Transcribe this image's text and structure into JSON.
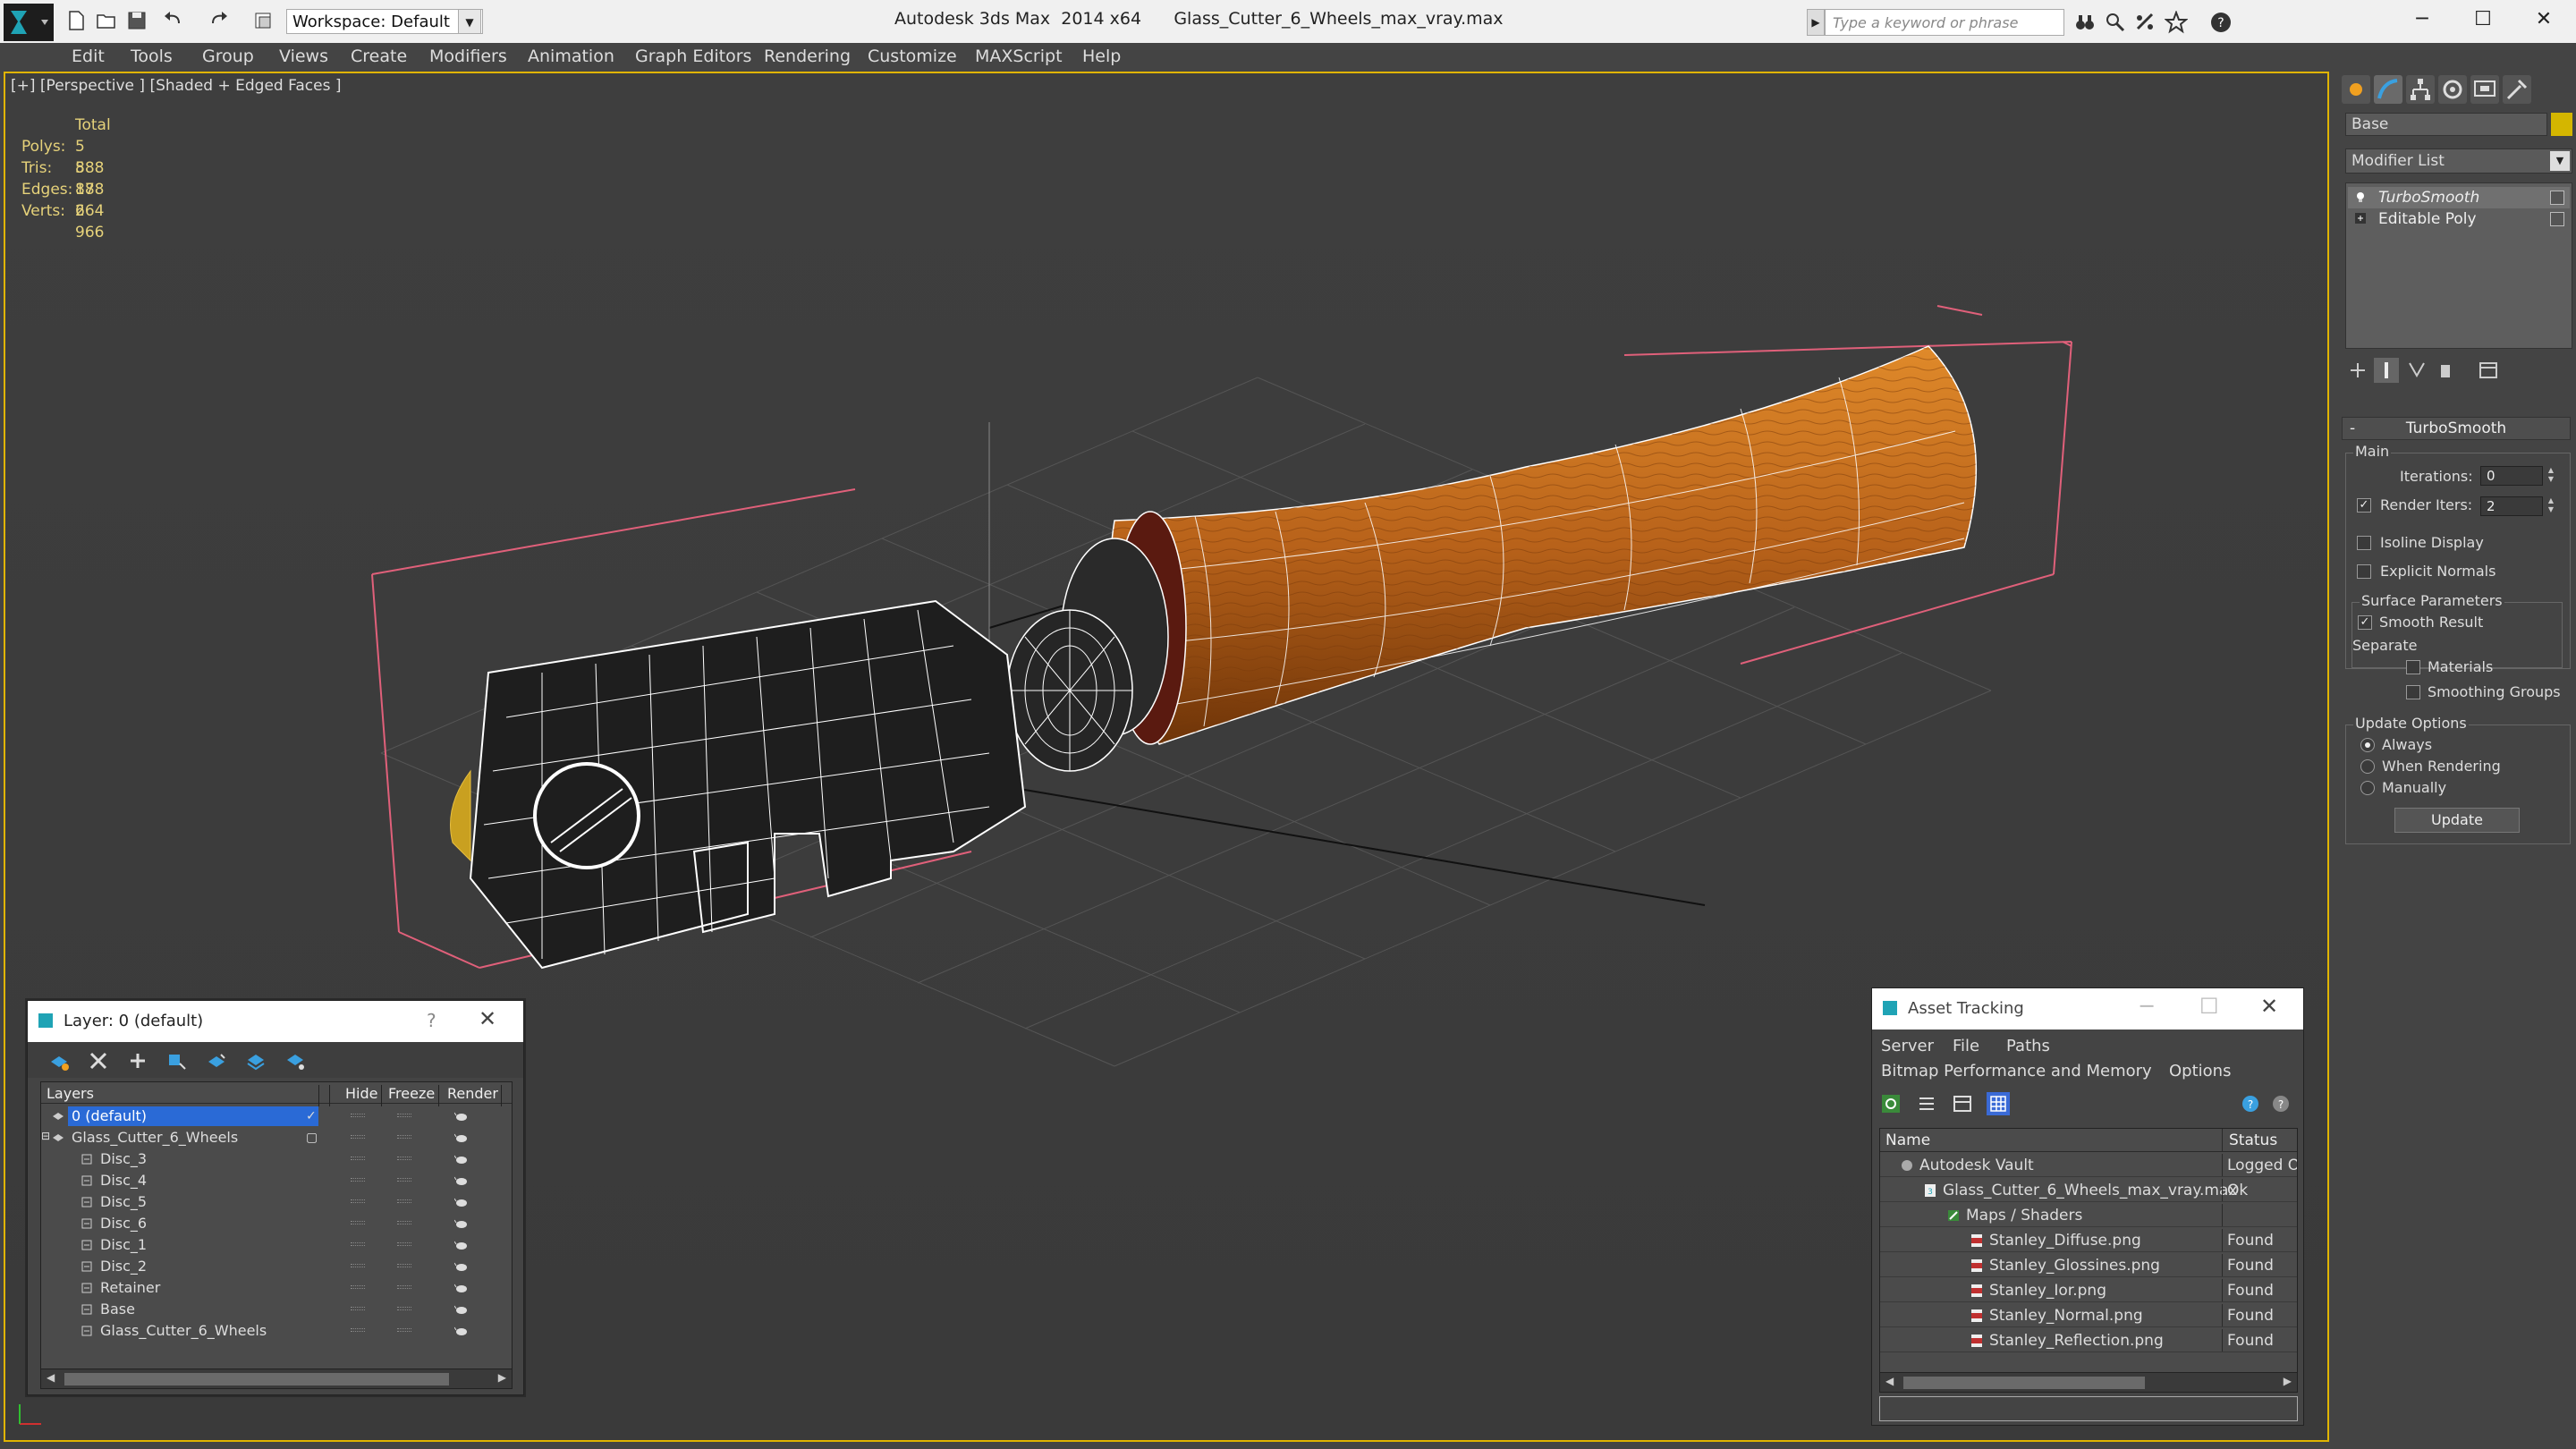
{
  "titlebar": {
    "workspace": "Workspace: Default",
    "app_title": "Autodesk 3ds Max  2014 x64",
    "file_title": "Glass_Cutter_6_Wheels_max_vray.max",
    "search_placeholder": "Type a keyword or phrase"
  },
  "menu": [
    "Edit",
    "Tools",
    "Group",
    "Views",
    "Create",
    "Modifiers",
    "Animation",
    "Graph Editors",
    "Rendering",
    "Customize",
    "MAXScript",
    "Help"
  ],
  "viewport": {
    "label": "[+] [Perspective ] [Shaded + Edged Faces ]",
    "stats_header": "Total",
    "stats": [
      {
        "key": "Polys:",
        "value": "5 888"
      },
      {
        "key": "Tris:",
        "value": "5 888"
      },
      {
        "key": "Edges:",
        "value": "17 664"
      },
      {
        "key": "Verts:",
        "value": "2 966"
      }
    ]
  },
  "command_panel": {
    "object_name": "Base",
    "object_color": "#d4b600",
    "modifier_list": "Modifier List",
    "stack": [
      "TurboSmooth",
      "Editable Poly"
    ],
    "rollout_title": "TurboSmooth",
    "main_group": "Main",
    "iterations_label": "Iterations:",
    "iterations_value": "0",
    "render_iters_label": "Render Iters:",
    "render_iters_value": "2",
    "isoline_display": "Isoline Display",
    "explicit_normals": "Explicit Normals",
    "surface_params": "Surface Parameters",
    "smooth_result": "Smooth Result",
    "separate": "Separate",
    "materials": "Materials",
    "smoothing_groups": "Smoothing Groups",
    "update_options": "Update Options",
    "always": "Always",
    "when_rendering": "When Rendering",
    "manually": "Manually",
    "update_button": "Update"
  },
  "layer_dialog": {
    "title": "Layer: 0 (default)",
    "help": "?",
    "columns": {
      "layers": "Layers",
      "hide": "Hide",
      "freeze": "Freeze",
      "render": "Render"
    },
    "rows": [
      {
        "name": "0 (default)",
        "level": 0,
        "selected": true
      },
      {
        "name": "Glass_Cutter_6_Wheels",
        "level": 0,
        "selected": false
      },
      {
        "name": "Disc_3",
        "level": 1
      },
      {
        "name": "Disc_4",
        "level": 1
      },
      {
        "name": "Disc_5",
        "level": 1
      },
      {
        "name": "Disc_6",
        "level": 1
      },
      {
        "name": "Disc_1",
        "level": 1
      },
      {
        "name": "Disc_2",
        "level": 1
      },
      {
        "name": "Retainer",
        "level": 1
      },
      {
        "name": "Base",
        "level": 1
      },
      {
        "name": "Glass_Cutter_6_Wheels",
        "level": 1
      }
    ]
  },
  "asset_dialog": {
    "title": "Asset Tracking",
    "menu1": [
      "Server",
      "File",
      "Paths"
    ],
    "menu2": [
      "Bitmap Performance and Memory",
      "Options"
    ],
    "col_name": "Name",
    "col_status": "Status",
    "rows": [
      {
        "name": "Autodesk Vault",
        "status": "Logged O",
        "indent": 0
      },
      {
        "name": "Glass_Cutter_6_Wheels_max_vray.max",
        "status": "Ok",
        "indent": 1
      },
      {
        "name": "Maps / Shaders",
        "status": "",
        "indent": 2
      },
      {
        "name": "Stanley_Diffuse.png",
        "status": "Found",
        "indent": 3
      },
      {
        "name": "Stanley_Glossines.png",
        "status": "Found",
        "indent": 3
      },
      {
        "name": "Stanley_Ior.png",
        "status": "Found",
        "indent": 3
      },
      {
        "name": "Stanley_Normal.png",
        "status": "Found",
        "indent": 3
      },
      {
        "name": "Stanley_Reflection.png",
        "status": "Found",
        "indent": 3
      }
    ]
  }
}
